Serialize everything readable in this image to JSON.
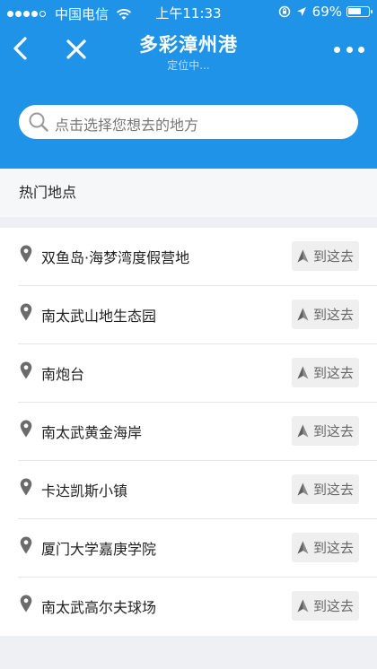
{
  "status_bar": {
    "carrier": "中国电信",
    "time": "上午11:33",
    "battery": "69%",
    "battery_level": 0.69
  },
  "nav": {
    "title": "多彩漳州港",
    "subtitle": "定位中..."
  },
  "search": {
    "placeholder": "点击选择您想去的地方"
  },
  "section": {
    "title": "热门地点"
  },
  "places": [
    {
      "name": "双鱼岛·海梦湾度假营地",
      "action": "到这去"
    },
    {
      "name": "南太武山地生态园",
      "action": "到这去"
    },
    {
      "name": "南炮台",
      "action": "到这去"
    },
    {
      "name": "南太武黄金海岸",
      "action": "到这去"
    },
    {
      "name": "卡达凯斯小镇",
      "action": "到这去"
    },
    {
      "name": "厦门大学嘉庚学院",
      "action": "到这去"
    },
    {
      "name": "南太武高尔夫球场",
      "action": "到这去"
    }
  ],
  "colors": {
    "header_bg": "#1f93e8",
    "page_bg": "#eef0f3",
    "button_bg": "#efefef"
  }
}
